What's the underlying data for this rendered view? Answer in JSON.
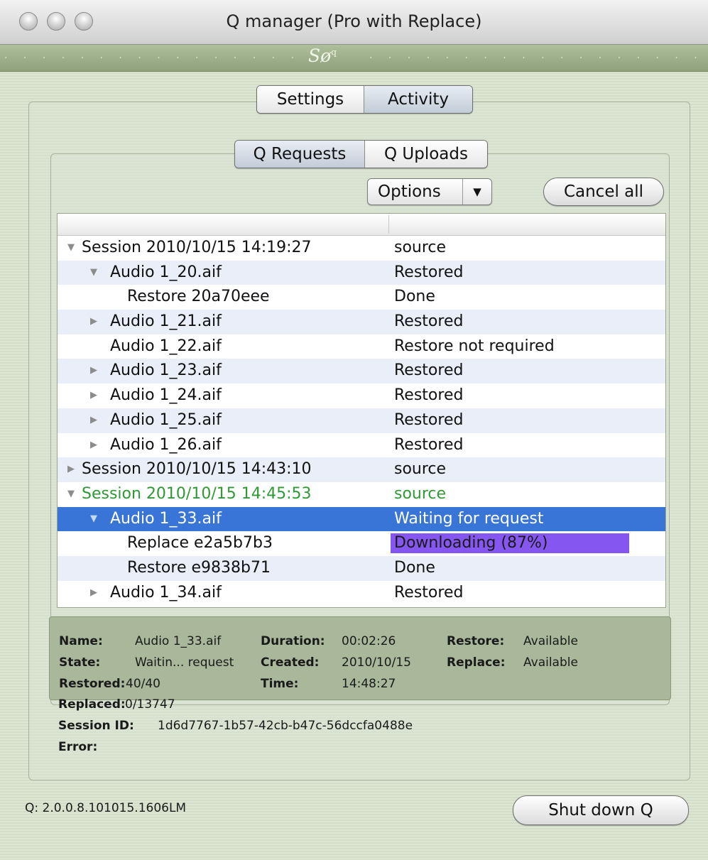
{
  "window": {
    "title": "Q manager (Pro with Replace)"
  },
  "brand": {
    "logo_text": "Sø",
    "logo_sup": "q",
    "dots": ". . . . . . . . . . . . . . . . . . . . . . . . . . . . . . . . . . . . . . . . . . . . . . . . ."
  },
  "main_tabs": [
    {
      "label": "Settings",
      "active": false
    },
    {
      "label": "Activity",
      "active": true
    }
  ],
  "sub_tabs": [
    {
      "label": "Q Requests",
      "active": true
    },
    {
      "label": "Q Uploads",
      "active": false
    }
  ],
  "toolbar": {
    "options_label": "Options",
    "options_arrow": "▼",
    "cancel_all_label": "Cancel all"
  },
  "table": {
    "rows": [
      {
        "name": "Session 2010/10/15 14:19:27",
        "status": "source",
        "level": 0,
        "disclosure": "▼"
      },
      {
        "name": "Audio 1_20.aif",
        "status": "Restored",
        "level": 1,
        "disclosure": "▼"
      },
      {
        "name": "Restore 20a70eee",
        "status": "Done",
        "level": 2,
        "disclosure": ""
      },
      {
        "name": "Audio 1_21.aif",
        "status": "Restored",
        "level": 1,
        "disclosure": "▶"
      },
      {
        "name": "Audio 1_22.aif",
        "status": "Restore not required",
        "level": 1,
        "disclosure": ""
      },
      {
        "name": "Audio 1_23.aif",
        "status": "Restored",
        "level": 1,
        "disclosure": "▶"
      },
      {
        "name": "Audio 1_24.aif",
        "status": "Restored",
        "level": 1,
        "disclosure": "▶"
      },
      {
        "name": "Audio 1_25.aif",
        "status": "Restored",
        "level": 1,
        "disclosure": "▶"
      },
      {
        "name": "Audio 1_26.aif",
        "status": "Restored",
        "level": 1,
        "disclosure": "▶"
      },
      {
        "name": "Session 2010/10/15 14:43:10",
        "status": "source",
        "level": 0,
        "disclosure": "▶"
      },
      {
        "name": "Session 2010/10/15 14:45:53",
        "status": "source",
        "level": 0,
        "disclosure": "▼",
        "highlight": "green"
      },
      {
        "name": "Audio 1_33.aif",
        "status": "Waiting for request",
        "level": 1,
        "disclosure": "▼",
        "selected": true
      },
      {
        "name": "Replace e2a5b7b3",
        "status": "Downloading (87%)",
        "level": 2,
        "disclosure": "",
        "progress": 0.87
      },
      {
        "name": "Restore e9838b71",
        "status": "Done",
        "level": 2,
        "disclosure": ""
      },
      {
        "name": "Audio 1_34.aif",
        "status": "Restored",
        "level": 1,
        "disclosure": "▶"
      }
    ]
  },
  "details": {
    "name_label": "Name:",
    "name_value": "Audio 1_33.aif",
    "duration_label": "Duration:",
    "duration_value": "00:02:26",
    "restore_label": "Restore:",
    "restore_value": "Available",
    "state_label": "State:",
    "state_value": "Waitin... request",
    "created_label": "Created:",
    "created_value": "2010/10/15",
    "replace_label": "Replace:",
    "replace_value": "Available",
    "restored_label": "Restored:",
    "restored_value": "40/40",
    "time_label": "Time:",
    "time_value": "14:48:27",
    "replaced_label": "Replaced:",
    "replaced_value": "0/13747",
    "session_label": "Session ID:",
    "session_value": "1d6d7767-1b57-42cb-b47c-56dccfa0488e",
    "error_label": "Error:",
    "error_value": ""
  },
  "footer": {
    "version": "Q: 2.0.0.8.101015.1606LM",
    "shutdown_label": "Shut down Q"
  }
}
